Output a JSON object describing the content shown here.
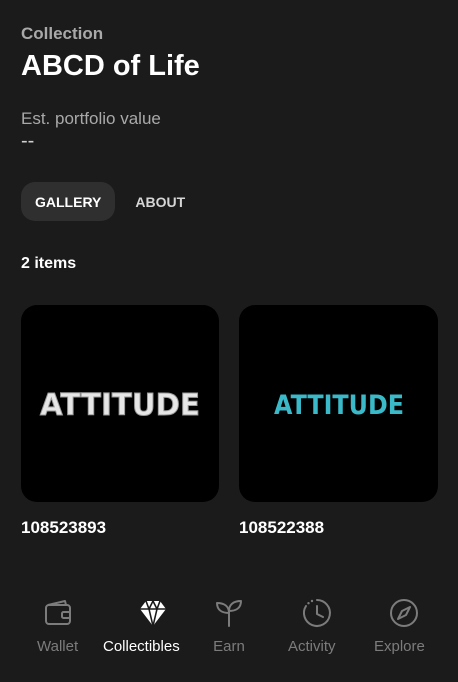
{
  "header": {
    "collection_label": "Collection",
    "collection_title": "ABCD of Life",
    "portfolio_label": "Est. portfolio value",
    "portfolio_value": "--"
  },
  "tabs": [
    {
      "label": "GALLERY",
      "active": true
    },
    {
      "label": "ABOUT",
      "active": false
    }
  ],
  "items_count": "2 items",
  "items": [
    {
      "name": "108523893",
      "art_text": "ATTITUDE",
      "art_color": "#e6e6e6"
    },
    {
      "name": "108522388",
      "art_text": "ATTITUDE",
      "art_color": "#3ab9c9"
    }
  ],
  "bottom_nav": [
    {
      "label": "Wallet",
      "icon": "wallet-icon",
      "active": false
    },
    {
      "label": "Collectibles",
      "icon": "diamond-icon",
      "active": true
    },
    {
      "label": "Earn",
      "icon": "sprout-icon",
      "active": false
    },
    {
      "label": "Activity",
      "icon": "clock-icon",
      "active": false
    },
    {
      "label": "Explore",
      "icon": "compass-icon",
      "active": false
    }
  ],
  "colors": {
    "background": "#1b1b1b",
    "tab_active_bg": "#2f2f2f",
    "muted_text": "#a9a9a9",
    "nav_inactive": "#7c7c7c",
    "card_bg": "#000000"
  }
}
